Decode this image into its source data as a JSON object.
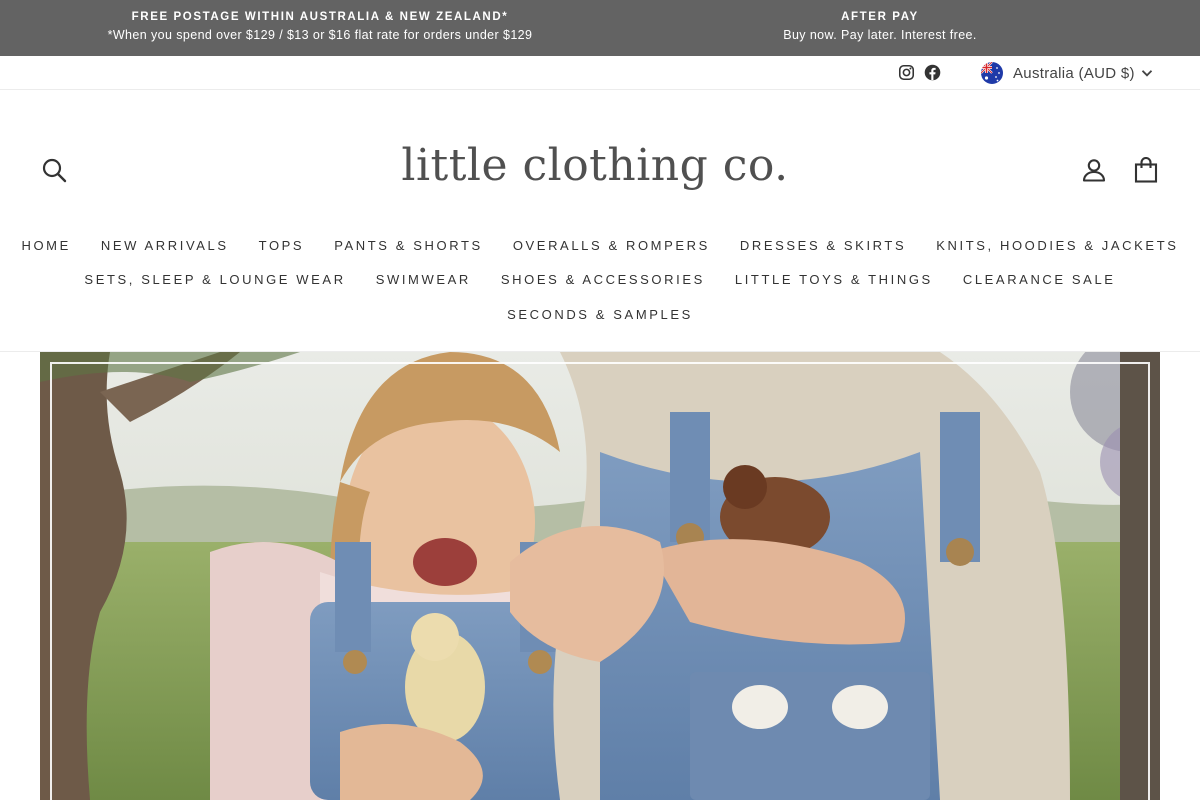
{
  "announcement": {
    "postage_title": "FREE POSTAGE WITHIN AUSTRALIA & NEW ZEALAND*",
    "postage_detail": "*When you spend over $129 / $13 or $16 flat rate for orders under $129",
    "afterpay_title": "AFTER PAY",
    "afterpay_detail": "Buy now. Pay later. Interest free."
  },
  "utility": {
    "social_icons": [
      "instagram-icon",
      "facebook-icon"
    ],
    "currency": {
      "label": "Australia (AUD $)",
      "flag_icon": "australia-flag-icon"
    }
  },
  "header": {
    "logo": "little clothing co.",
    "icons": [
      "search-icon",
      "account-icon",
      "cart-icon"
    ]
  },
  "nav": {
    "row1": [
      "HOME",
      "NEW ARRIVALS",
      "TOPS",
      "PANTS & SHORTS",
      "OVERALLS & ROMPERS",
      "DRESSES & SKIRTS",
      "KNITS, HOODIES & JACKETS"
    ],
    "row2": [
      "SETS, SLEEP & LOUNGE WEAR",
      "SWIMWEAR",
      "SHOES & ACCESSORIES",
      "LITTLE TOYS & THINGS",
      "CLEARANCE SALE"
    ],
    "row3": [
      "SECONDS & SAMPLES"
    ]
  },
  "colors": {
    "announcement_bg": "#636363",
    "text": "#333333",
    "logo": "#505050"
  }
}
